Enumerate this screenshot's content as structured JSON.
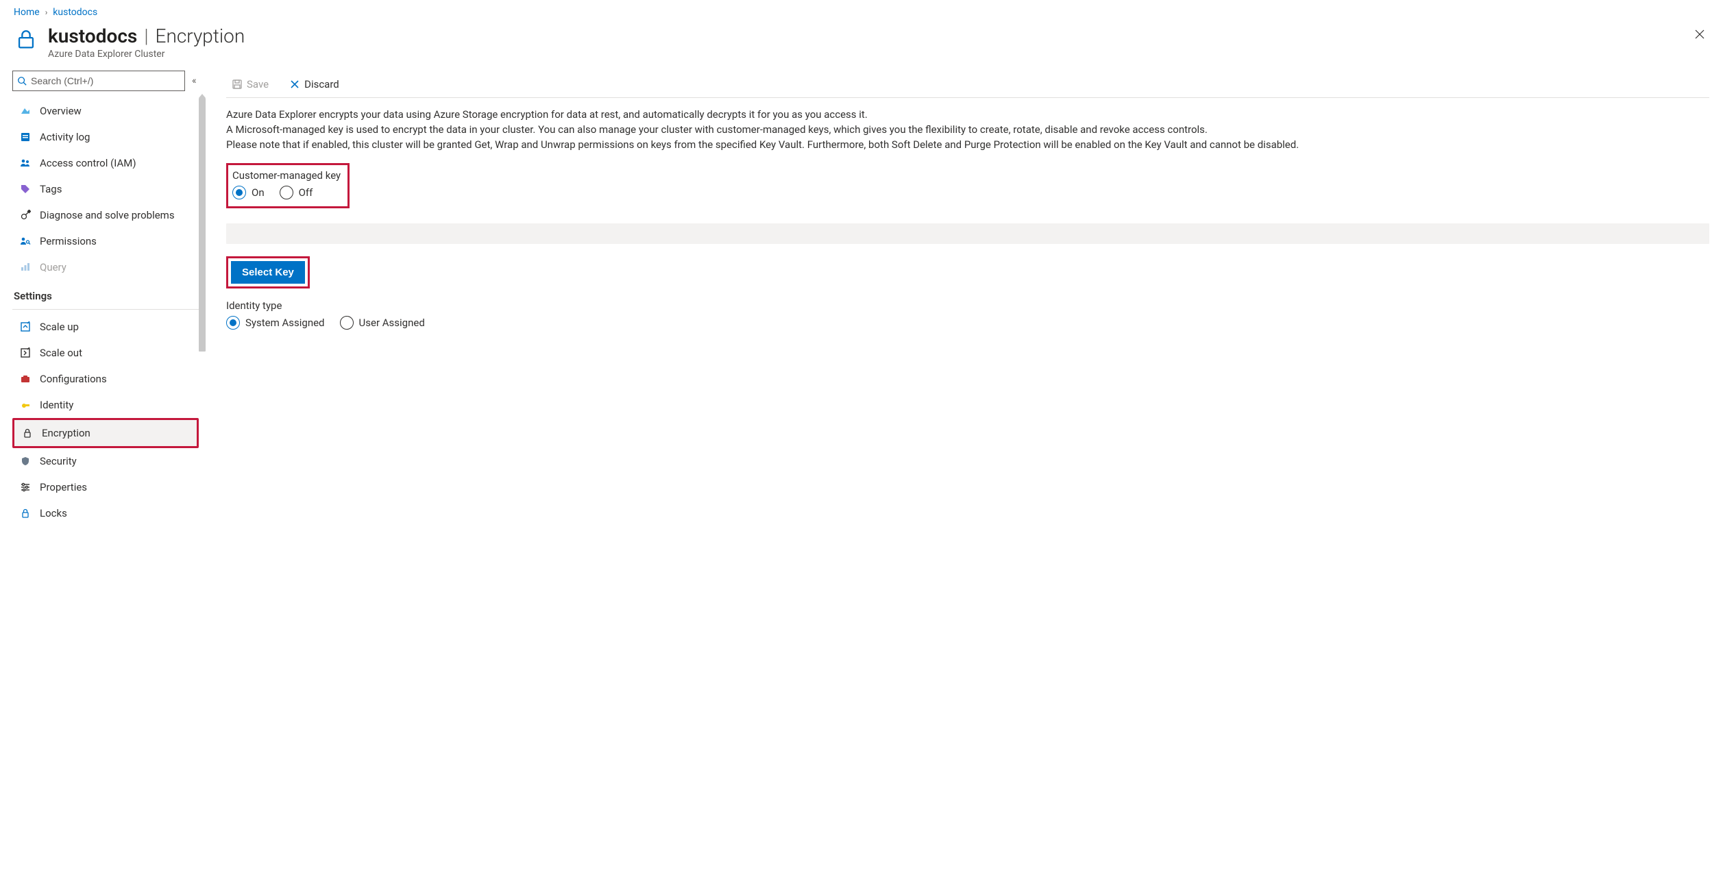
{
  "breadcrumb": {
    "home": "Home",
    "resource": "kustodocs"
  },
  "header": {
    "title": "kustodocs",
    "separator": "|",
    "section": "Encryption",
    "subtitle": "Azure Data Explorer Cluster"
  },
  "sidebar": {
    "search_placeholder": "Search (Ctrl+/)",
    "items_top": [
      {
        "label": "Overview",
        "icon": "overview"
      },
      {
        "label": "Activity log",
        "icon": "activity"
      },
      {
        "label": "Access control (IAM)",
        "icon": "iam"
      },
      {
        "label": "Tags",
        "icon": "tag"
      },
      {
        "label": "Diagnose and solve problems",
        "icon": "diagnose"
      },
      {
        "label": "Permissions",
        "icon": "permissions"
      },
      {
        "label": "Query",
        "icon": "query",
        "disabled": true
      }
    ],
    "settings_label": "Settings",
    "items_settings": [
      {
        "label": "Scale up",
        "icon": "scaleup"
      },
      {
        "label": "Scale out",
        "icon": "scaleout"
      },
      {
        "label": "Configurations",
        "icon": "config"
      },
      {
        "label": "Identity",
        "icon": "identity"
      },
      {
        "label": "Encryption",
        "icon": "encryption",
        "selected": true
      },
      {
        "label": "Security",
        "icon": "security"
      },
      {
        "label": "Properties",
        "icon": "properties"
      },
      {
        "label": "Locks",
        "icon": "locks"
      }
    ]
  },
  "commandbar": {
    "save": "Save",
    "discard": "Discard"
  },
  "description": {
    "line1": "Azure Data Explorer encrypts your data using Azure Storage encryption for data at rest, and automatically decrypts it for you as you access it.",
    "line2": "A Microsoft-managed key is used to encrypt the data in your cluster. You can also manage your cluster with customer-managed keys, which gives you the flexibility to create, rotate, disable and revoke access controls.",
    "line3": "Please note that if enabled, this cluster will be granted Get, Wrap and Unwrap permissions on keys from the specified Key Vault. Furthermore, both Soft Delete and Purge Protection will be enabled on the Key Vault and cannot be disabled."
  },
  "cmk": {
    "label": "Customer-managed key",
    "on": "On",
    "off": "Off"
  },
  "select_key": "Select Key",
  "identity": {
    "label": "Identity type",
    "system": "System Assigned",
    "user": "User Assigned"
  }
}
